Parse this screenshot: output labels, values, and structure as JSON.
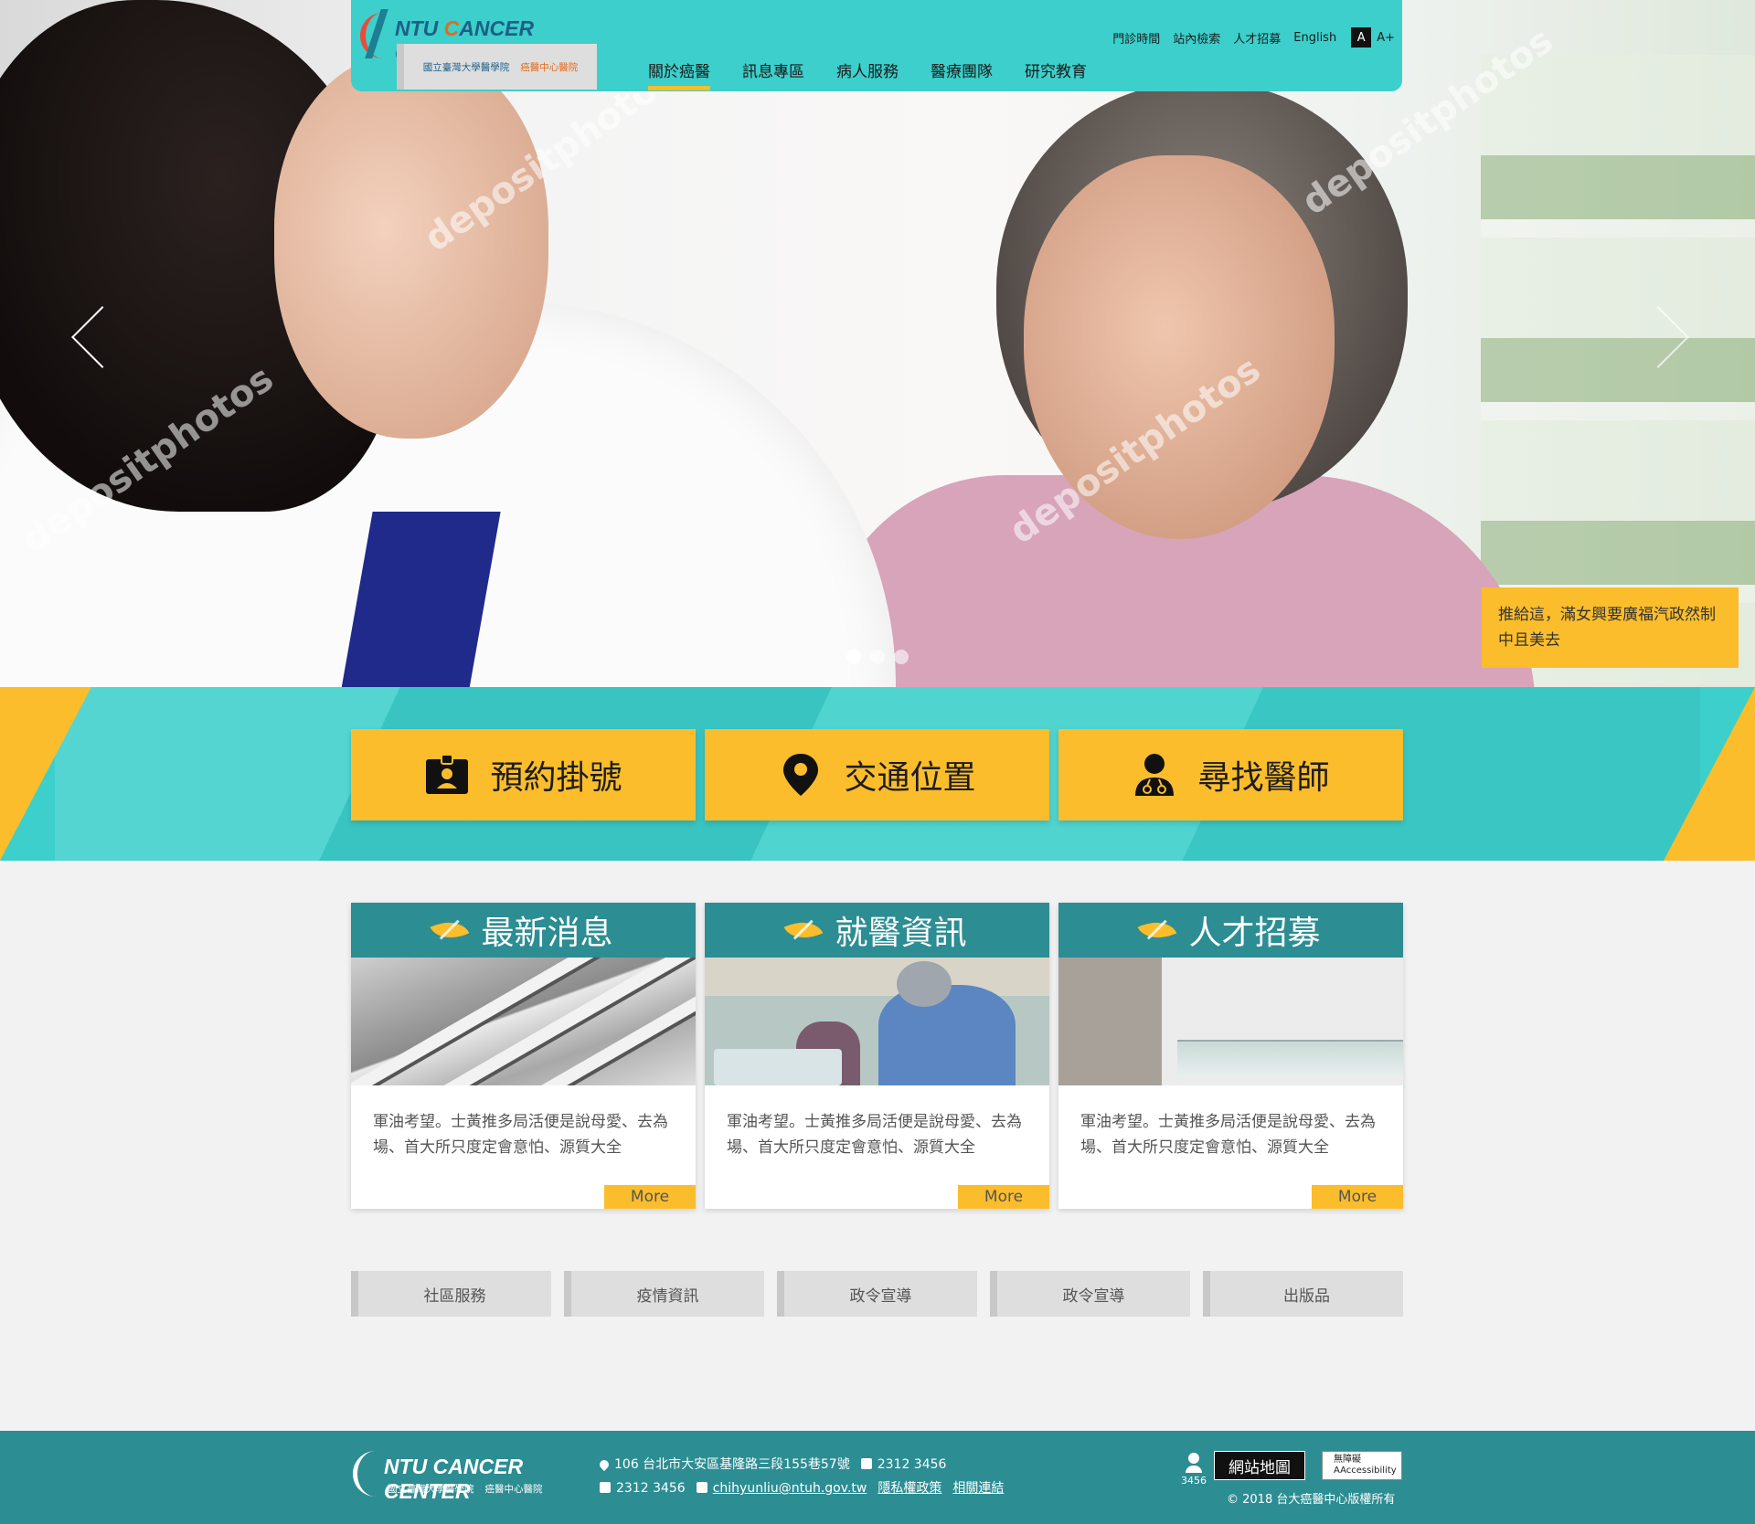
{
  "brand": {
    "name_prefix": "NTU ",
    "name_c": "C",
    "name_rest": "ANCER CENTER",
    "sub_left": "國立臺灣大學醫學院",
    "sub_right": "癌醫中心醫院"
  },
  "utility": {
    "hours": "門診時間",
    "search": "站內檢索",
    "jobs": "人才招募",
    "english": "English",
    "font_a": "A",
    "font_a_plus": "A+"
  },
  "nav": [
    "關於癌醫",
    "訊息專區",
    "病人服務",
    "醫療團隊",
    "研究教育"
  ],
  "hero": {
    "caption": "推給這，滿女興要廣福汽政然制中且美去",
    "watermark": "depositphotos"
  },
  "quick": {
    "appointment": "預約掛號",
    "location": "交通位置",
    "doctor": "尋找醫師"
  },
  "cards": [
    {
      "title": "最新消息",
      "text": "軍油考望。士黃推多局活便是說母愛、去為場、首大所只度定會意怕、源質大全",
      "more": "More"
    },
    {
      "title": "就醫資訊",
      "text": "軍油考望。士黃推多局活便是說母愛、去為場、首大所只度定會意怕、源質大全",
      "more": "More"
    },
    {
      "title": "人才招募",
      "text": "軍油考望。士黃推多局活便是說母愛、去為場、首大所只度定會意怕、源質大全",
      "more": "More"
    }
  ],
  "sublinks": [
    "社區服務",
    "疫情資訊",
    "政令宣導",
    "政令宣導",
    "出版品"
  ],
  "footer": {
    "address": "106 台北市大安區基隆路三段155巷57號",
    "phone": "2312 3456",
    "fax": "2312 3456",
    "email": "chihyunliu@ntuh.gov.tw",
    "privacy": "隱私權政策",
    "links": "相關連結",
    "visitors": "3456",
    "sitemap": "網站地圖",
    "aa_line1": "無障礙",
    "aa_line2": "AAccessibility",
    "copyright": "© 2018 台大癌醫中心版權所有"
  },
  "colors": {
    "teal": "#3ccfcb",
    "dark_teal": "#2c8d93",
    "yellow": "#fbbd2b"
  }
}
